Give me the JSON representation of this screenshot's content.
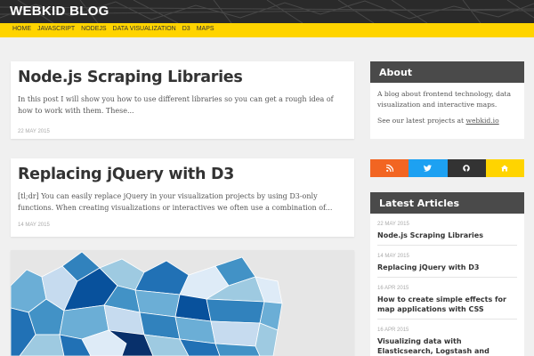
{
  "brand": "WEBKID BLOG",
  "nav": [
    "HOME",
    "JAVASCRIPT",
    "NODEJS",
    "DATA VISUALIZATION",
    "D3",
    "MAPS"
  ],
  "posts": [
    {
      "title": "Node.js Scraping Libraries",
      "excerpt": "In this post I will show you how to use different libraries so you can get a rough idea of how to work with them. These...",
      "date": "22 MAY 2015"
    },
    {
      "title": "Replacing jQuery with D3",
      "excerpt": "[tl;dr] You can easily replace jQuery in your visualization projects by using D3-only functions. When creating visualizations or interactives we often use a combination of...",
      "date": "14 MAY 2015"
    }
  ],
  "about": {
    "heading": "About",
    "text": "A blog about frontend technology, data visualization and interactive maps.",
    "projects_prefix": "See our latest projects at",
    "projects_link": "webkid.io"
  },
  "social": [
    {
      "icon": "rss-icon",
      "color": "#f26522"
    },
    {
      "icon": "twitter-icon",
      "color": "#1da1f2"
    },
    {
      "icon": "github-icon",
      "color": "#333333"
    },
    {
      "icon": "home-icon",
      "color": "#ffd400"
    }
  ],
  "latest": {
    "heading": "Latest Articles",
    "articles": [
      {
        "date": "22 MAY 2015",
        "title": "Node.js Scraping Libraries"
      },
      {
        "date": "14 MAY 2015",
        "title": "Replacing jQuery with D3"
      },
      {
        "date": "16 APR 2015",
        "title": "How to create simple effects for map applications with CSS"
      },
      {
        "date": "16 APR 2015",
        "title": "Visualizing data with Elasticsearch, Logstash and Kibana"
      }
    ]
  },
  "colors": {
    "accent": "#ffd400",
    "header": "#2a2a2a",
    "sidebar_head": "#4a4a4a"
  }
}
